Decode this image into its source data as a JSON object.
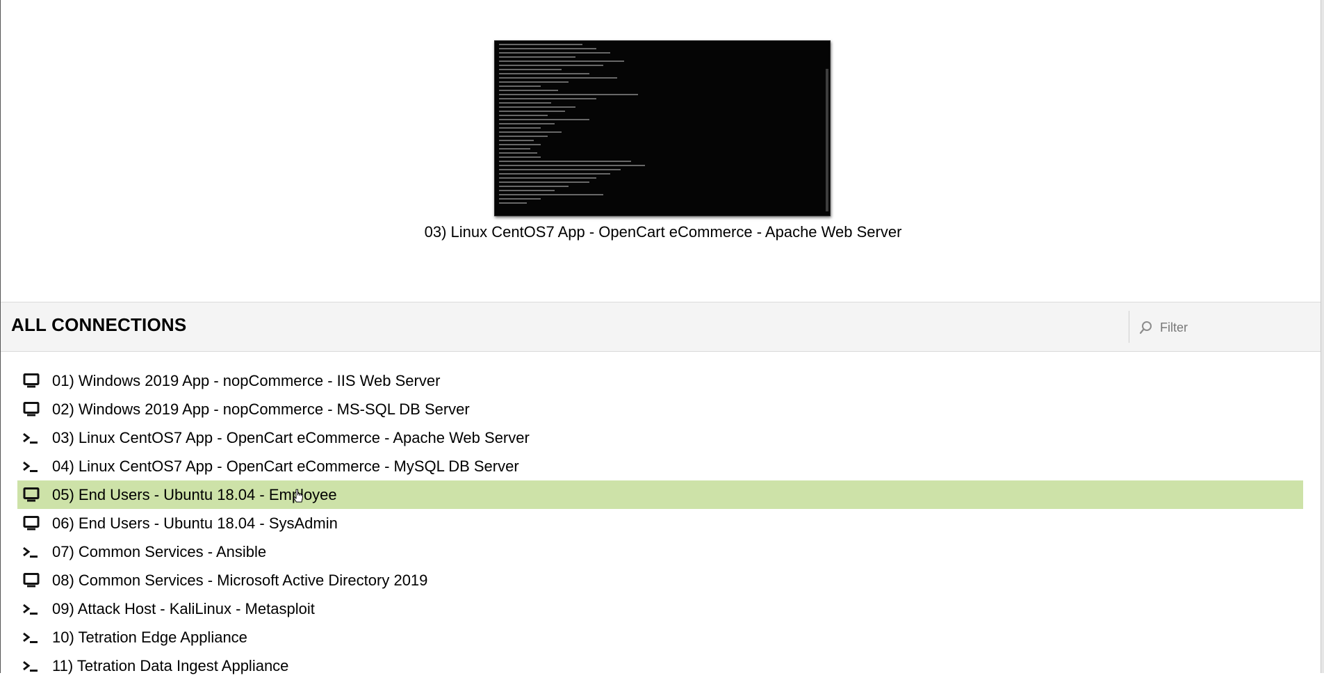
{
  "recent": {
    "caption": "03) Linux CentOS7 App - OpenCart eCommerce - Apache Web Server"
  },
  "section": {
    "title": "ALL CONNECTIONS",
    "filter_placeholder": "Filter"
  },
  "connections": [
    {
      "label": "01) Windows 2019 App - nopCommerce - IIS Web Server",
      "icon": "desktop-icon"
    },
    {
      "label": "02) Windows 2019 App - nopCommerce - MS-SQL DB Server",
      "icon": "desktop-icon"
    },
    {
      "label": "03) Linux CentOS7 App - OpenCart eCommerce - Apache Web Server",
      "icon": "terminal-icon"
    },
    {
      "label": "04) Linux CentOS7 App - OpenCart eCommerce - MySQL DB Server",
      "icon": "terminal-icon"
    },
    {
      "label": "05) End Users - Ubuntu 18.04 - Employee",
      "icon": "desktop-icon",
      "selected": true
    },
    {
      "label": "06) End Users - Ubuntu 18.04 - SysAdmin",
      "icon": "desktop-icon"
    },
    {
      "label": "07) Common Services - Ansible",
      "icon": "terminal-icon"
    },
    {
      "label": "08) Common Services - Microsoft Active Directory 2019",
      "icon": "desktop-icon"
    },
    {
      "label": "09) Attack Host - KaliLinux - Metasploit",
      "icon": "terminal-icon"
    },
    {
      "label": "10) Tetration Edge Appliance",
      "icon": "terminal-icon"
    },
    {
      "label": "11) Tetration Data Ingest Appliance",
      "icon": "terminal-icon"
    }
  ],
  "colors": {
    "selected_row": "#cde2a8",
    "header_bg": "#f4f4f4"
  }
}
